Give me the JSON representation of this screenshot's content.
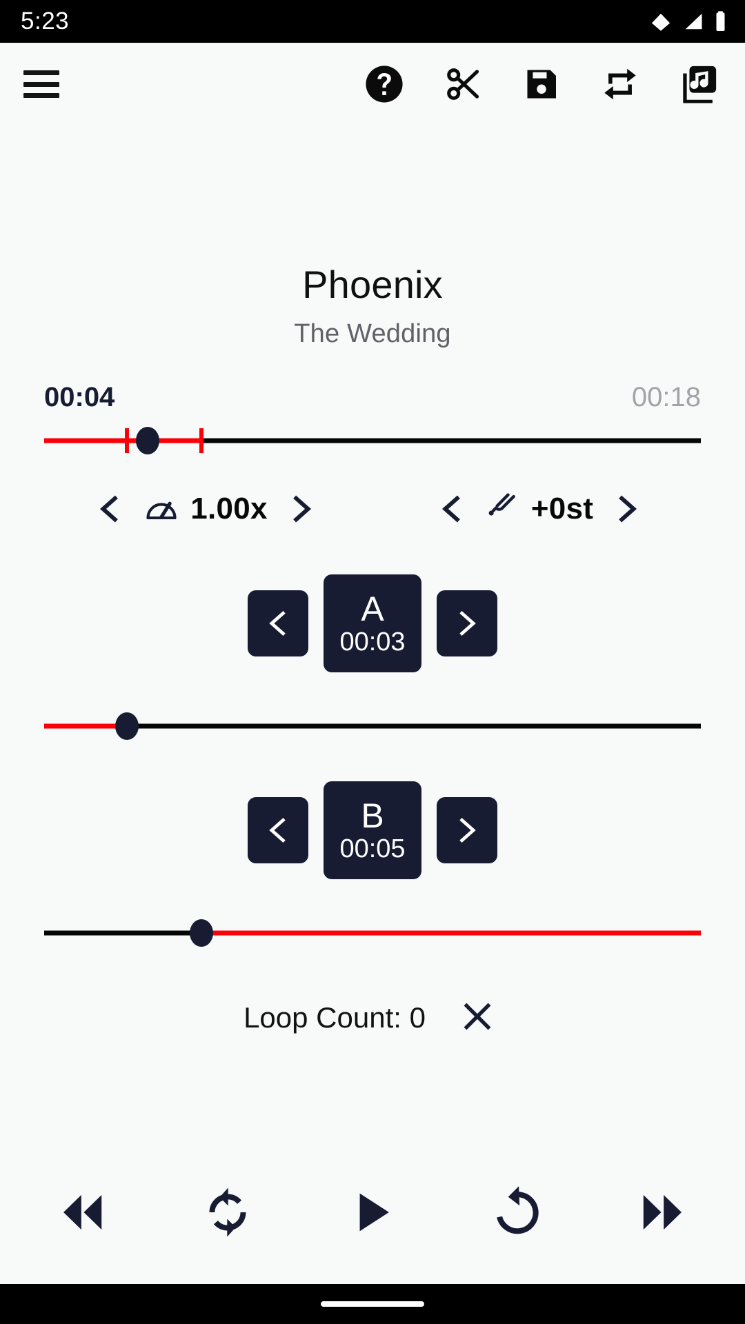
{
  "status_bar": {
    "time": "5:23",
    "icons": [
      "wifi-icon",
      "cell-signal-icon",
      "battery-icon"
    ]
  },
  "toolbar": {
    "menu_icon": "hamburger-menu-icon",
    "actions": [
      {
        "name": "help-icon",
        "label": "Help"
      },
      {
        "name": "cut-icon",
        "label": "Cut"
      },
      {
        "name": "save-icon",
        "label": "Save"
      },
      {
        "name": "repeat-icon",
        "label": "Repeat"
      },
      {
        "name": "music-library-icon",
        "label": "Library"
      }
    ]
  },
  "track": {
    "title": "Phoenix",
    "subtitle": "The Wedding"
  },
  "progress": {
    "current_time": "00:04",
    "total_time": "00:18",
    "position_percent": 15.8,
    "loop_start_percent": 12.6,
    "loop_end_percent": 24.0,
    "track_color": "#050505",
    "fill_color": "#fb0007",
    "thumb_color": "#171c33"
  },
  "speed": {
    "icon": "speedometer-icon",
    "value": "1.00x",
    "prev_icon": "chevron-left-icon",
    "next_icon": "chevron-right-icon"
  },
  "pitch": {
    "icon": "tuning-fork-icon",
    "value": "+0st",
    "prev_icon": "chevron-left-icon",
    "next_icon": "chevron-right-icon"
  },
  "marker_a": {
    "letter": "A",
    "time": "00:03",
    "dec_icon": "chevron-left-icon",
    "inc_icon": "chevron-right-icon",
    "slider_percent": 12.6
  },
  "marker_b": {
    "letter": "B",
    "time": "00:05",
    "dec_icon": "chevron-left-icon",
    "inc_icon": "chevron-right-icon",
    "slider_percent": 24.0
  },
  "loop": {
    "label": "Loop Count: 0",
    "clear_icon": "close-x-icon"
  },
  "transport": {
    "buttons": [
      {
        "name": "rewind-icon",
        "label": "Rewind"
      },
      {
        "name": "sync-loop-icon",
        "label": "Loop"
      },
      {
        "name": "play-icon",
        "label": "Play"
      },
      {
        "name": "restart-icon",
        "label": "Restart"
      },
      {
        "name": "fast-forward-icon",
        "label": "Fast forward"
      }
    ]
  },
  "theme": {
    "accent": "#fb0007",
    "dark": "#171c33",
    "background": "#f8f9f9"
  }
}
